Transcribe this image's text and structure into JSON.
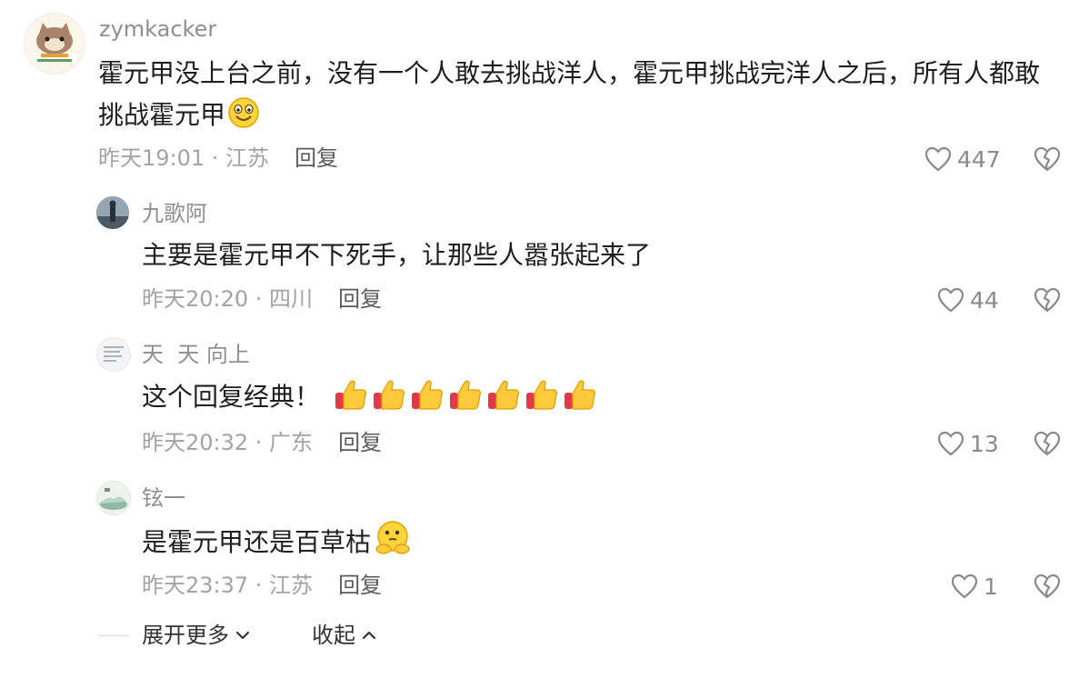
{
  "comments": [
    {
      "username": "zymkacker",
      "text": "霍元甲没上台之前，没有一个人敢去挑战洋人，霍元甲挑战完洋人之后，所有人都敢挑战霍元甲",
      "meta": "昨天19:01 · 江苏",
      "reply_label": "回复",
      "likes": "447",
      "emoji": "grinning-face-emoji"
    },
    {
      "username": "九歌阿",
      "text": "主要是霍元甲不下死手，让那些人嚣张起来了",
      "meta": "昨天20:20 · 四川",
      "reply_label": "回复",
      "likes": "44"
    },
    {
      "username": "天  天 向上",
      "text": "这个回复经典！",
      "meta": "昨天20:32 · 广东",
      "reply_label": "回复",
      "likes": "13",
      "emoji": "thumbs-up-emoji",
      "emoji_count": 7
    },
    {
      "username": "铉一",
      "text": "是霍元甲还是百草枯",
      "meta": "昨天23:37 · 江苏",
      "reply_label": "回复",
      "likes": "1",
      "emoji": "thinking-face-emoji"
    }
  ],
  "footer": {
    "expand_label": "展开更多",
    "collapse_label": "收起"
  },
  "icons": {
    "like": "heart-outline-icon",
    "dislike": "broken-heart-icon",
    "expand": "chevron-down-icon",
    "collapse": "chevron-up-icon"
  },
  "colors": {
    "text": "#1f1f1f",
    "name": "#8f8f8f",
    "meta": "#a3a3a3"
  }
}
